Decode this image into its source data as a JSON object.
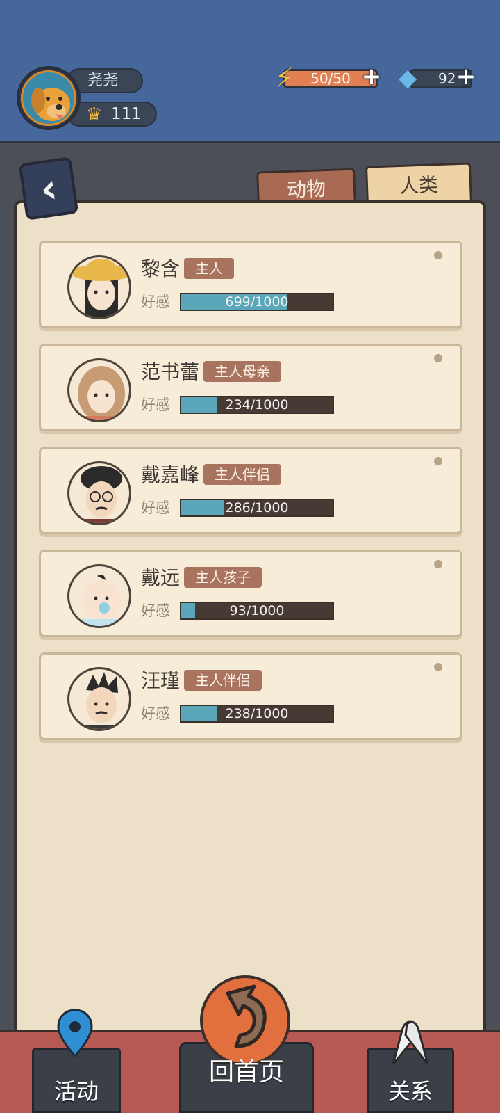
{
  "header": {
    "player_name": "尧尧",
    "level": "111",
    "energy": "50/50",
    "gems": "92"
  },
  "tabs": [
    {
      "label": "动物",
      "selected": false
    },
    {
      "label": "人类",
      "selected": true
    }
  ],
  "characters": [
    {
      "name": "黎含",
      "role": "主人",
      "favor_label": "好感",
      "favor_text": "699/1000",
      "favor_value": 699,
      "favor_max": 1000
    },
    {
      "name": "范书蕾",
      "role": "主人母亲",
      "favor_label": "好感",
      "favor_text": "234/1000",
      "favor_value": 234,
      "favor_max": 1000
    },
    {
      "name": "戴嘉峰",
      "role": "主人伴侣",
      "favor_label": "好感",
      "favor_text": "286/1000",
      "favor_value": 286,
      "favor_max": 1000
    },
    {
      "name": "戴远",
      "role": "主人孩子",
      "favor_label": "好感",
      "favor_text": "93/1000",
      "favor_value": 93,
      "favor_max": 1000
    },
    {
      "name": "汪瑾",
      "role": "主人伴侣",
      "favor_label": "好感",
      "favor_text": "238/1000",
      "favor_value": 238,
      "favor_max": 1000
    }
  ],
  "bottom_nav": {
    "activity": "活动",
    "home": "回首页",
    "relation": "关系"
  },
  "colors": {
    "header_bg": "#45679c",
    "panel_bg": "#ece0c8",
    "favor_fill": "#5aa7b9",
    "role_tag": "#a8735f",
    "bottom_bar": "#b65a53",
    "home_button": "#e2703f"
  },
  "icons": {
    "avatar": "golden-retriever-avatar-icon",
    "crown": "crown-icon",
    "energy": "lightning-bolt-icon",
    "gem": "diamond-icon",
    "back": "chevron-left-icon",
    "activity": "map-pin-icon",
    "home": "return-arrow-icon",
    "relation": "handshake-icon"
  }
}
